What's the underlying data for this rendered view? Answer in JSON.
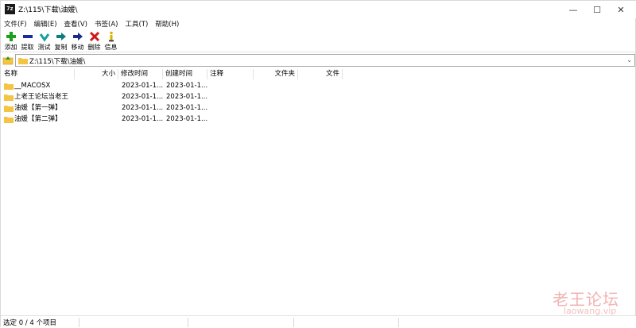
{
  "window": {
    "title": "Z:\\115\\下载\\油媛\\",
    "app_icon_text": "7z",
    "buttons": {
      "minimize": "—",
      "maximize": "☐",
      "close": "✕"
    }
  },
  "menu": [
    "文件(F)",
    "编辑(E)",
    "查看(V)",
    "书签(A)",
    "工具(T)",
    "帮助(H)"
  ],
  "toolbar": [
    {
      "label": "添加",
      "icon": "add-icon",
      "color": "#1aa01a"
    },
    {
      "label": "提取",
      "icon": "extract-icon",
      "color": "#1a2aa0"
    },
    {
      "label": "测试",
      "icon": "test-icon",
      "color": "#1aa0a0"
    },
    {
      "label": "复制",
      "icon": "copy-icon",
      "color": "#0b7d7d"
    },
    {
      "label": "移动",
      "icon": "move-icon",
      "color": "#1a2a8a"
    },
    {
      "label": "删除",
      "icon": "delete-icon",
      "color": "#d01818"
    },
    {
      "label": "信息",
      "icon": "info-icon",
      "color": "#d8b400"
    }
  ],
  "address": {
    "path": "Z:\\115\\下载\\油媛\\"
  },
  "columns": [
    "名称",
    "大小",
    "修改时间",
    "创建时间",
    "注释",
    "文件夹",
    "文件"
  ],
  "rows": [
    {
      "name": "__MACOSX",
      "modified": "2023-01-1...",
      "created": "2023-01-1..."
    },
    {
      "name": "上老王论坛当老王",
      "modified": "2023-01-1...",
      "created": "2023-01-1..."
    },
    {
      "name": "油媛【第一弹】",
      "modified": "2023-01-1...",
      "created": "2023-01-1..."
    },
    {
      "name": "油媛【第二弹】",
      "modified": "2023-01-1...",
      "created": "2023-01-1..."
    }
  ],
  "status": {
    "text": "选定 0 / 4 个项目"
  },
  "watermark": {
    "cn": "老王论坛",
    "en": "laowang.vip"
  }
}
